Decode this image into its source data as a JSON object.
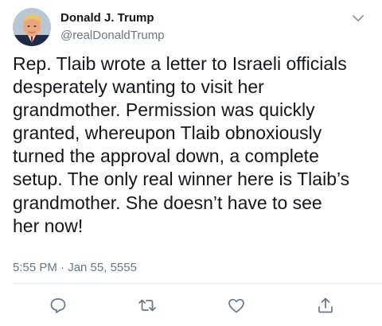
{
  "author": {
    "display_name": "Donald J. Trump",
    "handle": "@realDonaldTrump",
    "avatar_icon": "profile-photo"
  },
  "tweet": {
    "text": "Rep. Tlaib wrote a letter to Israeli officials\ndesperately wanting to visit her\ngrandmother. Permission was quickly\ngranted, whereupon Tlaib obnoxiously\nturned the approval down, a complete\nsetup. The only real winner here is Tlaib’s\ngrandmother. She doesn’t have to see\nher now!",
    "timestamp": "5:55 PM · Jan 55, 5555"
  },
  "actions": [
    {
      "icon": "reply-icon"
    },
    {
      "icon": "retweet-icon"
    },
    {
      "icon": "like-icon"
    },
    {
      "icon": "share-icon"
    }
  ],
  "colors": {
    "text": "#14171a",
    "secondary": "#657786",
    "divider": "#e1e8ed"
  }
}
